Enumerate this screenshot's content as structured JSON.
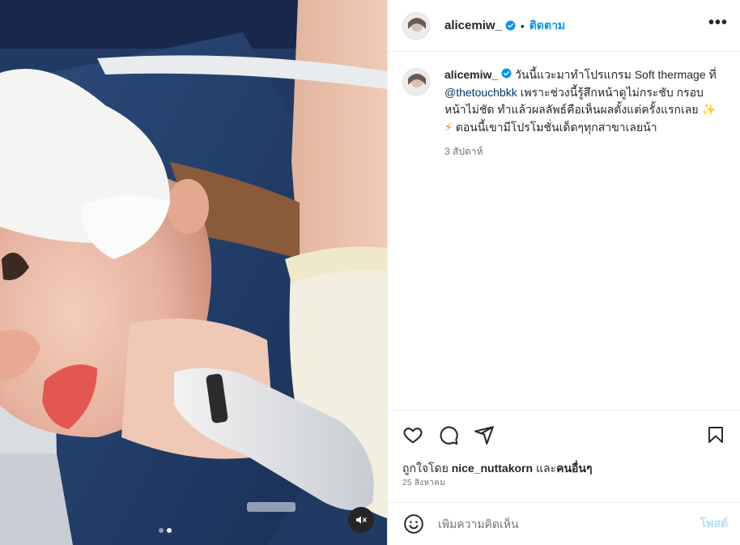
{
  "post": {
    "username": "alicemiw_",
    "separator": "•",
    "follow_label": "ติดตาม",
    "more_label": "•••"
  },
  "caption": {
    "username": "alicemiw_",
    "text_1": " วันนี้แวะมาทำโปรแกรม Soft thermage ที่ ",
    "mention": "@thetouchbkk",
    "text_2": " เพราะช่วงนี้รู้สึกหน้าดูไม่กระชับ กรอบหน้าไม่ชัด ทำแล้วผลลัพธ์คือเห็นผลตั้งแต่ครั้งแรกเลย ",
    "emoji_1": "✨",
    "emoji_2": "⚡",
    "text_3": "  ตอนนี้เขามีโปรโมชั่นเด็ดๆทุกสาขาเลยน้า",
    "time": "3 สัปดาห์"
  },
  "likes": {
    "prefix": "ถูกใจโดย ",
    "user": "nice_nuttakorn",
    "middle": " และ",
    "others": "คนอื่นๆ"
  },
  "date": "25 สิงหาคม",
  "comment": {
    "placeholder": "เพิ่มความคิดเห็น",
    "post_label": "โพสต์"
  },
  "media": {
    "carousel_count": 2,
    "carousel_active": 2
  },
  "colors": {
    "accent": "#0095f6",
    "verified": "#0095f6",
    "muted_text": "#737373",
    "post_disabled": "#b2dffc"
  },
  "icons": {
    "like": "heart-icon",
    "comment": "comment-icon",
    "share": "share-icon",
    "save": "bookmark-icon",
    "emoji": "emoji-icon",
    "mute": "muted-speaker-icon",
    "verified": "verified-badge-icon"
  }
}
